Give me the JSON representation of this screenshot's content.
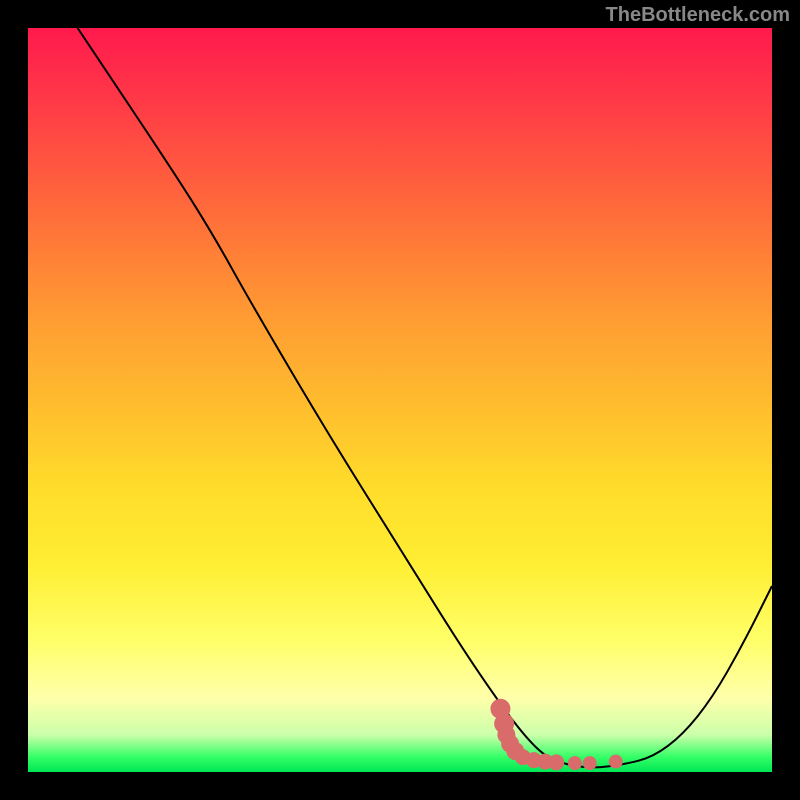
{
  "watermark": "TheBottleneck.com",
  "chart_data": {
    "type": "line",
    "title": "",
    "xlabel": "",
    "ylabel": "",
    "xlim": [
      0,
      100
    ],
    "ylim": [
      0,
      100
    ],
    "series": [
      {
        "name": "bottleneck-curve",
        "x": [
          0,
          10,
          20,
          25,
          30,
          40,
          50,
          60,
          68,
          72,
          76,
          80,
          84,
          88,
          92,
          96,
          100
        ],
        "y": [
          110,
          95,
          80,
          72,
          63,
          46,
          30,
          14,
          3,
          1,
          0.5,
          1,
          2,
          5,
          10,
          17,
          25
        ],
        "color": "#000000"
      }
    ],
    "markers": [
      {
        "x": 63.5,
        "y": 8.5,
        "size": 10
      },
      {
        "x": 64.0,
        "y": 6.5,
        "size": 10
      },
      {
        "x": 64.3,
        "y": 5.0,
        "size": 9
      },
      {
        "x": 64.8,
        "y": 3.8,
        "size": 9
      },
      {
        "x": 65.5,
        "y": 2.8,
        "size": 9
      },
      {
        "x": 66.5,
        "y": 2.0,
        "size": 8
      },
      {
        "x": 68.0,
        "y": 1.6,
        "size": 8
      },
      {
        "x": 69.5,
        "y": 1.4,
        "size": 8
      },
      {
        "x": 71.0,
        "y": 1.3,
        "size": 8
      },
      {
        "x": 73.5,
        "y": 1.2,
        "size": 7
      },
      {
        "x": 75.5,
        "y": 1.2,
        "size": 7
      },
      {
        "x": 79.0,
        "y": 1.4,
        "size": 7
      }
    ],
    "marker_color": "#d96b6b",
    "gradient_stops": [
      {
        "pos": 0.0,
        "color": "#ff1a4d"
      },
      {
        "pos": 0.08,
        "color": "#ff3348"
      },
      {
        "pos": 0.18,
        "color": "#ff5540"
      },
      {
        "pos": 0.28,
        "color": "#ff7738"
      },
      {
        "pos": 0.38,
        "color": "#ff9933"
      },
      {
        "pos": 0.5,
        "color": "#ffbb2e"
      },
      {
        "pos": 0.62,
        "color": "#ffdd2a"
      },
      {
        "pos": 0.72,
        "color": "#ffee33"
      },
      {
        "pos": 0.82,
        "color": "#ffff66"
      },
      {
        "pos": 0.9,
        "color": "#ffffaa"
      },
      {
        "pos": 0.95,
        "color": "#ccffaa"
      },
      {
        "pos": 0.98,
        "color": "#33ff66"
      },
      {
        "pos": 1.0,
        "color": "#00e655"
      }
    ]
  }
}
